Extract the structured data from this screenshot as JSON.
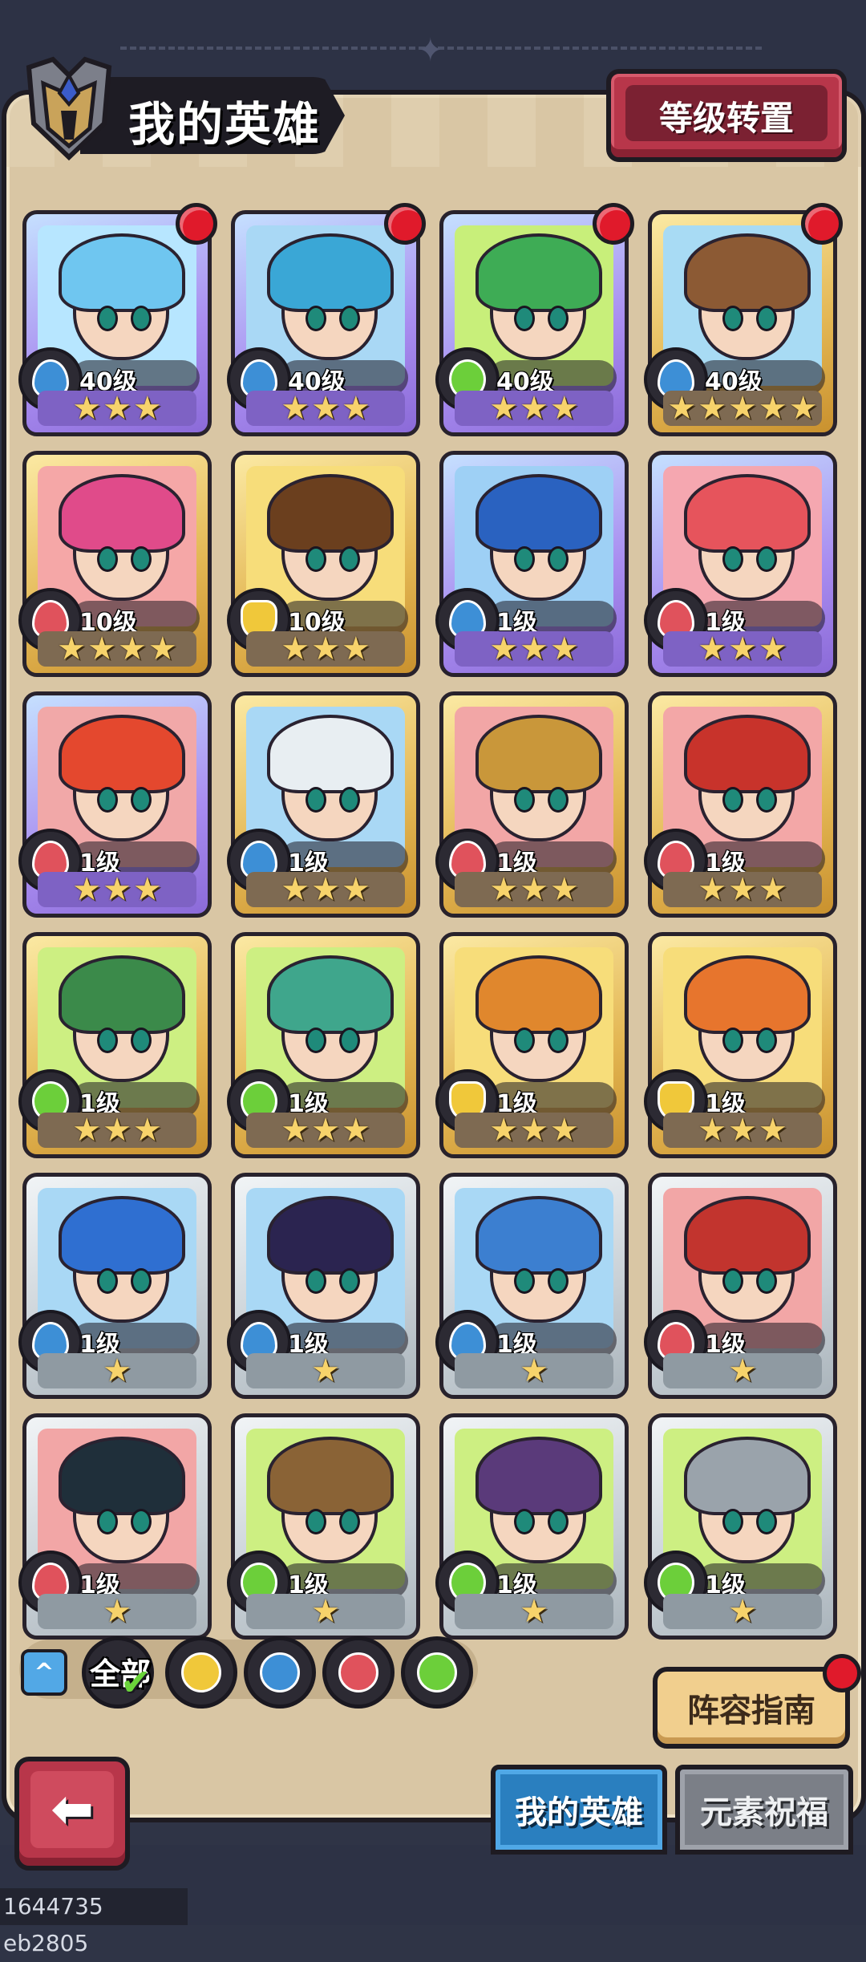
{
  "header": {
    "title": "我的英雄",
    "transfer_label": "等级转置"
  },
  "heroes": [
    {
      "level": "40级",
      "element": "water",
      "rarity": "purple",
      "stars": 3,
      "new": true,
      "hair": "#6fc6f0",
      "bg": "#b7e6ff"
    },
    {
      "level": "40级",
      "element": "water",
      "rarity": "purple",
      "stars": 3,
      "new": true,
      "hair": "#3aa7d6",
      "bg": "#a9d8f5"
    },
    {
      "level": "40级",
      "element": "wind",
      "rarity": "purple",
      "stars": 3,
      "new": true,
      "hair": "#3eac55",
      "bg": "#c8ef7a"
    },
    {
      "level": "40级",
      "element": "water",
      "rarity": "gold",
      "stars": 5,
      "new": true,
      "hair": "#8c5a34",
      "bg": "#a8dbf4"
    },
    {
      "level": "10级",
      "element": "fire",
      "rarity": "gold",
      "stars": 4,
      "new": false,
      "hair": "#e04b8a",
      "bg": "#f5a7a7"
    },
    {
      "level": "10级",
      "element": "earth",
      "rarity": "gold",
      "stars": 3,
      "new": false,
      "hair": "#6b3f1e",
      "bg": "#f7dd7a"
    },
    {
      "level": "1级",
      "element": "water",
      "rarity": "purple",
      "stars": 3,
      "new": false,
      "hair": "#2a62c0",
      "bg": "#9ed0f5"
    },
    {
      "level": "1级",
      "element": "fire",
      "rarity": "purple",
      "stars": 3,
      "new": false,
      "hair": "#e6545c",
      "bg": "#f5a7b0"
    },
    {
      "level": "1级",
      "element": "fire",
      "rarity": "purple",
      "stars": 3,
      "new": false,
      "hair": "#e4482e",
      "bg": "#f1a8a8"
    },
    {
      "level": "1级",
      "element": "water",
      "rarity": "gold",
      "stars": 3,
      "new": false,
      "hair": "#e8eef2",
      "bg": "#a9d8f5"
    },
    {
      "level": "1级",
      "element": "fire",
      "rarity": "gold",
      "stars": 3,
      "new": false,
      "hair": "#c9973a",
      "bg": "#f2a6a6"
    },
    {
      "level": "1级",
      "element": "fire",
      "rarity": "gold",
      "stars": 3,
      "new": false,
      "hair": "#c8332b",
      "bg": "#f3a7a7"
    },
    {
      "level": "1级",
      "element": "wind",
      "rarity": "gold",
      "stars": 3,
      "new": false,
      "hair": "#3b8a4a",
      "bg": "#cdef82"
    },
    {
      "level": "1级",
      "element": "wind",
      "rarity": "gold",
      "stars": 3,
      "new": false,
      "hair": "#3fa68c",
      "bg": "#cdef82"
    },
    {
      "level": "1级",
      "element": "earth",
      "rarity": "gold",
      "stars": 3,
      "new": false,
      "hair": "#e0872d",
      "bg": "#f7dd7a"
    },
    {
      "level": "1级",
      "element": "earth",
      "rarity": "gold",
      "stars": 3,
      "new": false,
      "hair": "#e7752d",
      "bg": "#f7dd7a"
    },
    {
      "level": "1级",
      "element": "water",
      "rarity": "silver",
      "stars": 1,
      "new": false,
      "hair": "#2f6fd1",
      "bg": "#a9d8f5"
    },
    {
      "level": "1级",
      "element": "water",
      "rarity": "silver",
      "stars": 1,
      "new": false,
      "hair": "#2b2450",
      "bg": "#a9d8f5"
    },
    {
      "level": "1级",
      "element": "water",
      "rarity": "silver",
      "stars": 1,
      "new": false,
      "hair": "#3c7fd0",
      "bg": "#a9d8f5"
    },
    {
      "level": "1级",
      "element": "fire",
      "rarity": "silver",
      "stars": 1,
      "new": false,
      "hair": "#c2342e",
      "bg": "#f2a6a6"
    },
    {
      "level": "1级",
      "element": "fire",
      "rarity": "silver",
      "stars": 1,
      "new": false,
      "hair": "#1f2f3a",
      "bg": "#f2a6a6"
    },
    {
      "level": "1级",
      "element": "wind",
      "rarity": "silver",
      "stars": 1,
      "new": false,
      "hair": "#8a6336",
      "bg": "#cdef82"
    },
    {
      "level": "1级",
      "element": "wind",
      "rarity": "silver",
      "stars": 1,
      "new": false,
      "hair": "#5a3a7a",
      "bg": "#cdef82"
    },
    {
      "level": "1级",
      "element": "wind",
      "rarity": "silver",
      "stars": 1,
      "new": false,
      "hair": "#9aa3ab",
      "bg": "#cdef82"
    }
  ],
  "filters": {
    "all_label": "全部",
    "elements": [
      "earth",
      "water",
      "fire",
      "wind"
    ]
  },
  "guide_label": "阵容指南",
  "tabs": {
    "my_heroes": "我的英雄",
    "element_blessing": "元素祝福"
  },
  "build_id": "1644735 eb2805",
  "colors": {
    "water": "#3d8fd6",
    "fire": "#e0525c",
    "wind": "#6ccf3a",
    "earth": "#f0c83a",
    "red_dot": "#e01a2b"
  }
}
